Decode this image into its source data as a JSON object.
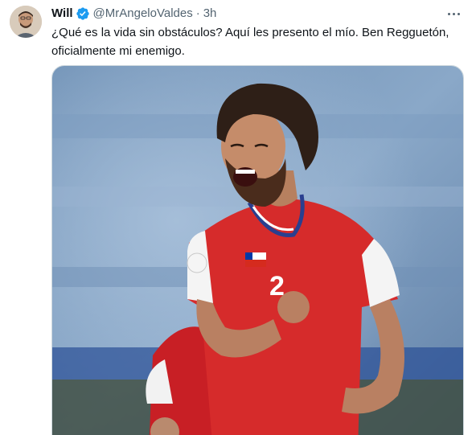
{
  "author": {
    "display_name": "Will",
    "handle": "@MrAngeloValdes",
    "separator": "·",
    "timestamp": "3h",
    "verified": true,
    "avatar_icon": "profile-photo"
  },
  "tweet": {
    "text": "¿Qué es la vida sin obstáculos? Aquí les presento el mío. Ben Regguetón, oficialmente mi enemigo."
  },
  "media": {
    "type": "photo",
    "jersey_number": "2"
  },
  "icons": {
    "verified": "verified-badge-icon",
    "more": "more-options-icon"
  },
  "colors": {
    "verified_blue": "#1d9bf0",
    "text_primary": "#0f1419",
    "text_secondary": "#536471",
    "jersey_red": "#d62b2b"
  }
}
